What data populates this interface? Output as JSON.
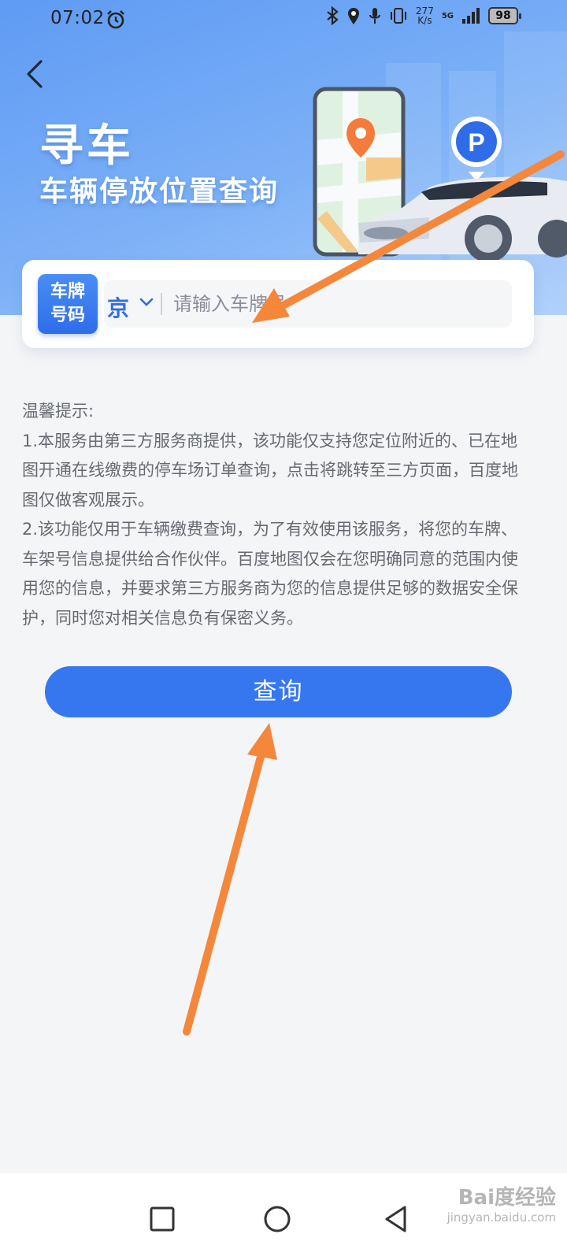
{
  "status_bar": {
    "time": "07:02",
    "network_speed_value": "277",
    "network_speed_unit": "K/s",
    "network_type": "5G",
    "battery": "98",
    "icons": [
      "alarm-icon",
      "bluetooth-icon",
      "location-icon",
      "mic-icon",
      "vibrate-icon",
      "signal-icon",
      "battery-icon"
    ]
  },
  "header": {
    "title": "寻车",
    "subtitle": "车辆停放位置查询"
  },
  "search": {
    "badge_line1": "车牌",
    "badge_line2": "号码",
    "province": "京",
    "placeholder": "请输入车牌号"
  },
  "notice": {
    "heading": "温馨提示:",
    "item1": "1.本服务由第三方服务商提供，该功能仅支持您定位附近的、已在地图开通在线缴费的停车场订单查询，点击将跳转至三方页面，百度地图仅做客观展示。",
    "item2": "2.该功能仅用于车辆缴费查询，为了有效使用该服务，将您的车牌、车架号信息提供给合作伙伴。百度地图仅会在您明确同意的范围内使用您的信息，并要求第三方服务商为您的信息提供足够的数据安全保护，同时您对相关信息负有保密义务。"
  },
  "actions": {
    "query_label": "查询"
  },
  "watermark": {
    "brand": "Bai度经验",
    "url": "jingyan.baidu.com"
  },
  "colors": {
    "accent": "#3677f0",
    "annotation_arrow": "#f5873a"
  }
}
